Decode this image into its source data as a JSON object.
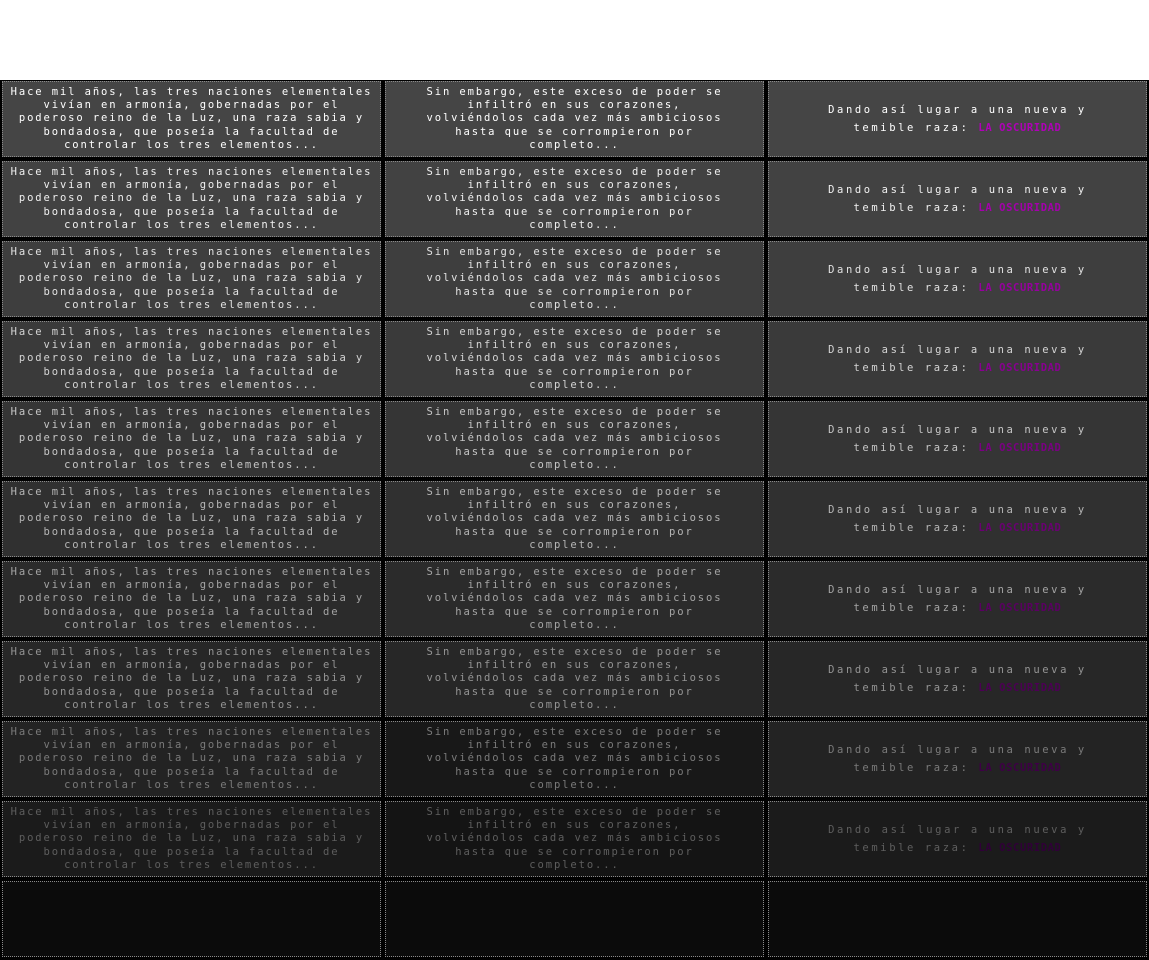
{
  "panels": {
    "col1": "Hace mil  años, las tres naciones elementales vivían en armonía, gobernadas por el poderoso reino de la Luz, una raza sabia y bondadosa, que poseía la facultad de controlar los tres elementos...",
    "col2": "Sin embargo, este exceso de poder se infiltró en sus corazones, volviéndolos cada vez más ambiciosos hasta que se corrompieron por completo...",
    "col3_lead": "Dando así lugar a una nueva y temible raza: ",
    "col3_highlight": "LA OSCURIDAD"
  },
  "colors": {
    "highlight": "#b000b8"
  },
  "fade_frames": [
    {
      "bg": [
        "#454545",
        "#454545",
        "#454545"
      ],
      "text": "#ffffff",
      "hl": "#b000b8"
    },
    {
      "bg": [
        "#424242",
        "#424242",
        "#424242"
      ],
      "text": "#f0f0f0",
      "hl": "#a400ab"
    },
    {
      "bg": [
        "#3e3e3e",
        "#3e3e3e",
        "#3e3e3e"
      ],
      "text": "#e2e2e2",
      "hl": "#96009e"
    },
    {
      "bg": [
        "#3a3a3a",
        "#3a3a3a",
        "#3a3a3a"
      ],
      "text": "#d4d4d4",
      "hl": "#880090"
    },
    {
      "bg": [
        "#353535",
        "#353535",
        "#353535"
      ],
      "text": "#c6c6c6",
      "hl": "#7a0082"
    },
    {
      "bg": [
        "#303030",
        "#303030",
        "#303030"
      ],
      "text": "#b6b6b6",
      "hl": "#6a0072"
    },
    {
      "bg": [
        "#2b2b2b",
        "#2b2b2b",
        "#2b2b2b"
      ],
      "text": "#a4a4a4",
      "hl": "#5a0062"
    },
    {
      "bg": [
        "#272727",
        "#272727",
        "#272727"
      ],
      "text": "#949494",
      "hl": "#4c0054"
    },
    {
      "bg": [
        "#232323",
        "#181818",
        "#232323"
      ],
      "text": "#7a7a7a",
      "hl": "#3e0046"
    },
    {
      "bg": [
        "#1b1b1b",
        "#141414",
        "#1b1b1b"
      ],
      "text": "#5e5e5e",
      "hl": "#300038"
    },
    {
      "bg": [
        "#0b0b0b",
        "#0b0b0b",
        "#0b0b0b"
      ],
      "text": null,
      "hl": null
    }
  ]
}
